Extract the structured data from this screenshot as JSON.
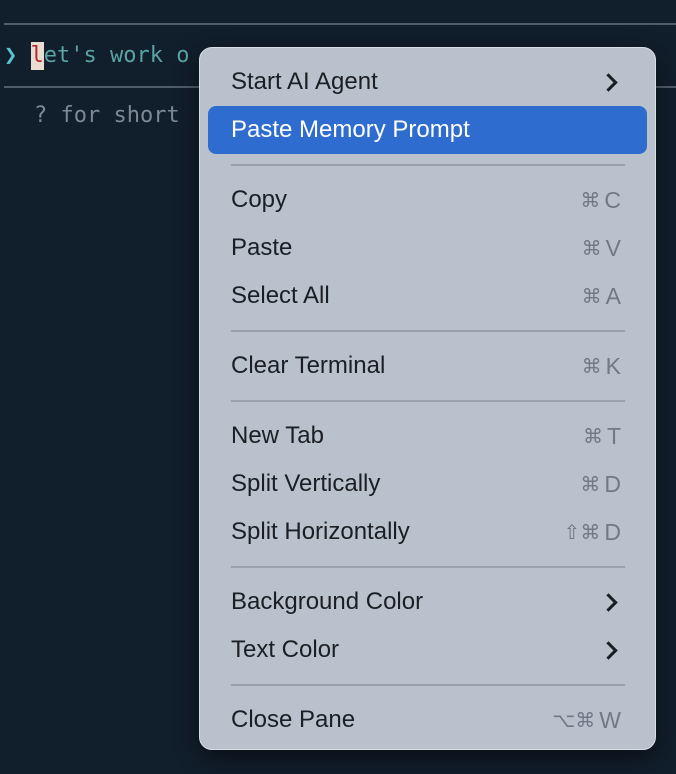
{
  "terminal": {
    "prompt_glyph": "❯",
    "cursor_char": "l",
    "typed_text": "et's work o",
    "hint": "? for short"
  },
  "menu": {
    "groups": [
      [
        {
          "label": "Start AI Agent",
          "submenu": true
        },
        {
          "label": "Paste Memory Prompt",
          "highlighted": true
        }
      ],
      [
        {
          "label": "Copy",
          "mods": "⌘",
          "key": "C"
        },
        {
          "label": "Paste",
          "mods": "⌘",
          "key": "V"
        },
        {
          "label": "Select All",
          "mods": "⌘",
          "key": "A"
        }
      ],
      [
        {
          "label": "Clear Terminal",
          "mods": "⌘",
          "key": "K"
        }
      ],
      [
        {
          "label": "New Tab",
          "mods": "⌘",
          "key": "T"
        },
        {
          "label": "Split Vertically",
          "mods": "⌘",
          "key": "D"
        },
        {
          "label": "Split Horizontally",
          "mods": "⇧⌘",
          "key": "D"
        }
      ],
      [
        {
          "label": "Background Color",
          "submenu": true
        },
        {
          "label": "Text Color",
          "submenu": true
        }
      ],
      [
        {
          "label": "Close Pane",
          "mods": "⌥⌘",
          "key": "W"
        }
      ]
    ]
  },
  "colors": {
    "terminal_bg": "#111e2b",
    "menu_bg": "#b8c1cc",
    "highlight": "#2f6ccf",
    "prompt": "#59c4cf"
  }
}
